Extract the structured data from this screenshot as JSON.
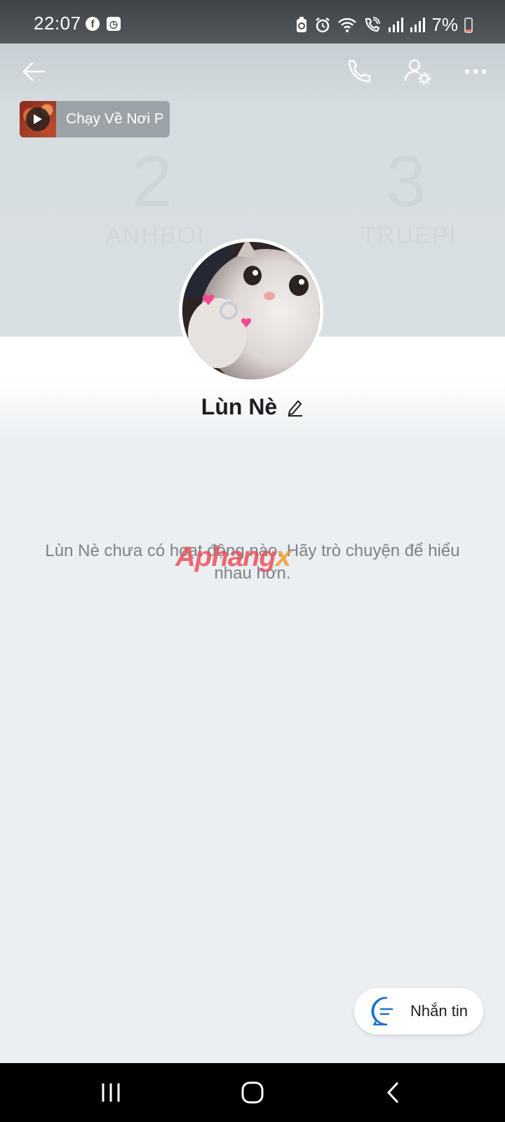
{
  "status_bar": {
    "time": "22:07",
    "battery_percent": "7%",
    "battery_level": 0.07,
    "left_icons": [
      "facebook-icon",
      "app-notification-icon"
    ],
    "right_icons": [
      "battery-saver-icon",
      "alarm-icon",
      "wifi-icon",
      "wifi-calling-icon",
      "signal-icon",
      "signal-icon"
    ]
  },
  "header": {
    "back_icon": "arrow-left-icon",
    "call_icon": "phone-icon",
    "settings_icon": "user-settings-icon",
    "more_icon": "more-dots-icon"
  },
  "music": {
    "title": "Chạy Về Nơi P"
  },
  "cover_ghost": {
    "left_number": "2",
    "left_label": "ANHBOI",
    "right_number": "3",
    "right_label": "TRUEPI"
  },
  "profile": {
    "name": "Lùn Nè"
  },
  "empty_state": {
    "message": "Lùn Nè chưa có hoạt động nào. Hãy trò chuyện để hiểu nhau hơn."
  },
  "watermark": {
    "text_main": "Aphang",
    "text_accent": "x"
  },
  "fab": {
    "label": "Nhắn tin"
  },
  "colors": {
    "accent": "#1a73c9",
    "battery_low": "#f06a4a",
    "cover": "#d9e0e3",
    "background": "#ebeff2"
  }
}
